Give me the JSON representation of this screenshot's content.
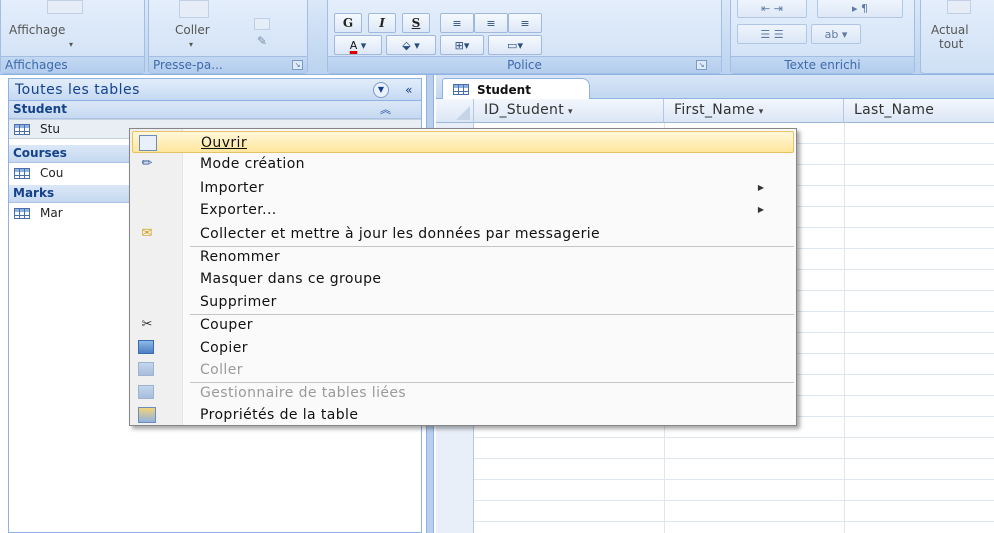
{
  "ribbon": {
    "groups": [
      {
        "label": "Affichages",
        "button": "Affichage"
      },
      {
        "label": "Presse-pa...",
        "button": "Coller"
      },
      {
        "label": "Police"
      },
      {
        "label": "Texte enrichi"
      },
      {
        "label": "",
        "button": "Actual\ntout"
      }
    ],
    "font_buttons": {
      "bold": "G",
      "italic": "I",
      "underline": "S"
    },
    "refresh_label": "Actual",
    "refresh_label2": "tout"
  },
  "nav": {
    "header": "Toutes les tables",
    "groups": [
      {
        "name": "Student",
        "items": [
          "Stu"
        ]
      },
      {
        "name": "Courses",
        "items": [
          "Cou"
        ]
      },
      {
        "name": "Marks",
        "items": [
          "Mar"
        ]
      }
    ]
  },
  "document": {
    "tab_label": "Student",
    "columns": [
      "ID_Student",
      "First_Name",
      "Last_Name"
    ]
  },
  "context_menu": {
    "items": [
      {
        "label": "Ouvrir",
        "icon": "open-table-icon",
        "highlighted": true
      },
      {
        "label": "Mode création",
        "icon": "design-view-icon"
      },
      {
        "label": "Importer",
        "submenu": true
      },
      {
        "label": "Exporter...",
        "submenu": true
      },
      {
        "label": "Collecter et mettre à jour les données par messagerie",
        "icon": "collect-data-icon"
      },
      {
        "label": "Renommer"
      },
      {
        "label": "Masquer dans ce groupe"
      },
      {
        "label": "Supprimer"
      },
      {
        "label": "Couper",
        "icon": "scissors-icon"
      },
      {
        "label": "Copier",
        "icon": "copy-icon"
      },
      {
        "label": "Coller",
        "icon": "paste-icon",
        "disabled": true
      },
      {
        "label": "Gestionnaire de tables liées",
        "icon": "linked-table-manager-icon",
        "disabled": true
      },
      {
        "label": "Propriétés de la table",
        "icon": "table-properties-icon"
      }
    ]
  },
  "colors": {
    "ribbon": "#c7dbf3",
    "highlight": "#ffe59c",
    "text_blue": "#15428b"
  }
}
